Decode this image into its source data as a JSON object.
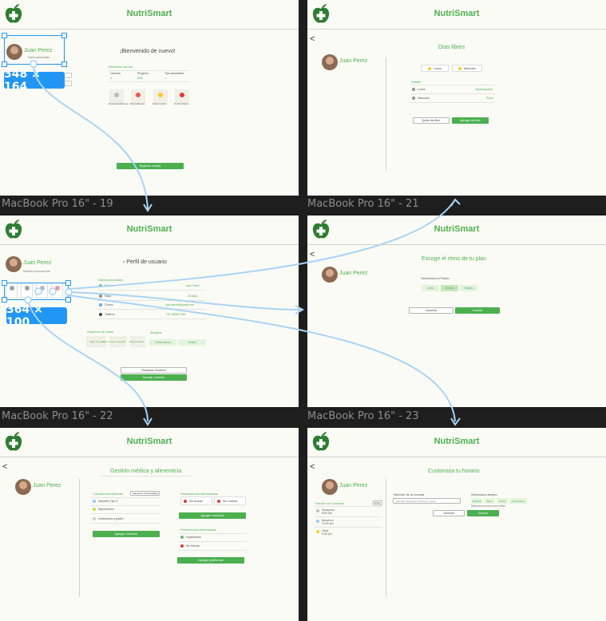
{
  "app": {
    "name": "NutriSmart",
    "user": "Juan Perez",
    "back_symbol": "<"
  },
  "frame_labels": {
    "f19": "MacBook Pro 16\" - 19",
    "f21": "MacBook Pro 16\" - 21",
    "f22": "MacBook Pro 16\" - 22",
    "f23": "MacBook Pro 16\" - 23"
  },
  "dimension_badges": {
    "home_avatar": "348 × 164",
    "profile_cards": "364 × 100"
  },
  "home": {
    "user_caption": "Datos personales",
    "welcome": "¡Bienvenido de nuevo!",
    "summary_title": "Resumen del día",
    "stats": [
      {
        "label": "Calorías",
        "value": "0"
      },
      {
        "label": "Progreso",
        "value": "60%"
      },
      {
        "label": "Tips saludables",
        "value": "1"
      }
    ],
    "cards": [
      "Recomendaciones",
      "Recordatorios",
      "Suplementos",
      "Control Dieta"
    ],
    "cta": "Registrar comida"
  },
  "free_days": {
    "title": "Días libres",
    "days": [
      "Lunes",
      "Miércoles"
    ],
    "detail_title": "Detalle",
    "rows": [
      {
        "label": "Lunes",
        "value": "Hamburguesa"
      },
      {
        "label": "Miércoles",
        "value": "Pizza"
      }
    ],
    "remove_btn": "Quitar día libre",
    "add_btn": "Agregar día libre"
  },
  "profile": {
    "user_caption": "Nombre personal foto",
    "title": "Perfil de usuario",
    "personal_title": "Datos personales",
    "fields": [
      {
        "label": "Nombre",
        "value": "Juan Perez"
      },
      {
        "label": "Edad",
        "value": "28 años"
      },
      {
        "label": "Correo",
        "value": "juan.perez@gmail.com"
      },
      {
        "label": "Teléfono",
        "value": "+51 989647983"
      }
    ],
    "goals_title": "Objetivos de salud",
    "goals": [
      "Bajar de peso",
      "Ganar masa muscular",
      "Mejorar salud"
    ],
    "allergies_title": "Alergias",
    "allergies": [
      "Frutos secos",
      "Gluten"
    ],
    "restore_btn": "Restaurar Cambios",
    "save_btn": "Guardar Cambios"
  },
  "pace": {
    "title": "Escoge el ritmo de tu plan",
    "select_label": "Selecciona el Ritmo:",
    "options": [
      "Lento",
      "Normal",
      "Rápido"
    ],
    "selected": "Normal",
    "cancel_btn": "Cancelar",
    "save_btn": "Guardar"
  },
  "medical": {
    "title": "Gestión médica y alimenticia",
    "conditions_title": "Condiciones Médicas",
    "conditions_filter": "Categoría / Profundidad",
    "conditions": [
      "Diabetes Tipo 2",
      "Hipertensión",
      "Intolerancia a gluten"
    ],
    "add_condition": "Agregar Condición",
    "restrictions_title": "Restricciones Alimentarias",
    "restrictions": [
      "Sin Azúcar",
      "Sin Lácteos"
    ],
    "add_restriction": "Agregar restricción",
    "preferences_title": "Preferencias Alimenticias",
    "preferences": [
      "Vegetariano",
      "Sin frituras"
    ],
    "add_preference": "Agregar preferencia"
  },
  "schedule": {
    "title": "Customiza tu horario",
    "meal_schedule_title": "Horario de Comidas",
    "meal_schedule_edit": "Editar",
    "meals": [
      {
        "name": "Desayuno",
        "time": "8:00 am"
      },
      {
        "name": "Almuerzo",
        "time": "12:00 pm"
      },
      {
        "name": "Cena",
        "time": "6:30 pm"
      }
    ],
    "meal_name_label": "Nombre de la comida",
    "meal_name_placeholder": "Ejemplo: Desayuno, Almuerzo, Cena",
    "time_label": "Selecciona tiempo",
    "time_options": [
      "Mañana",
      "Tarde",
      "Noche",
      "Personalizar"
    ],
    "time_hint": "Selecciona hora para editar",
    "cancel_btn": "Cancelar",
    "save_btn": "Guardar"
  },
  "colors": {
    "accent": "#4caf50",
    "selection": "#2196f3",
    "canvas": "#1e1e1e",
    "frame": "#fbfbf5"
  }
}
